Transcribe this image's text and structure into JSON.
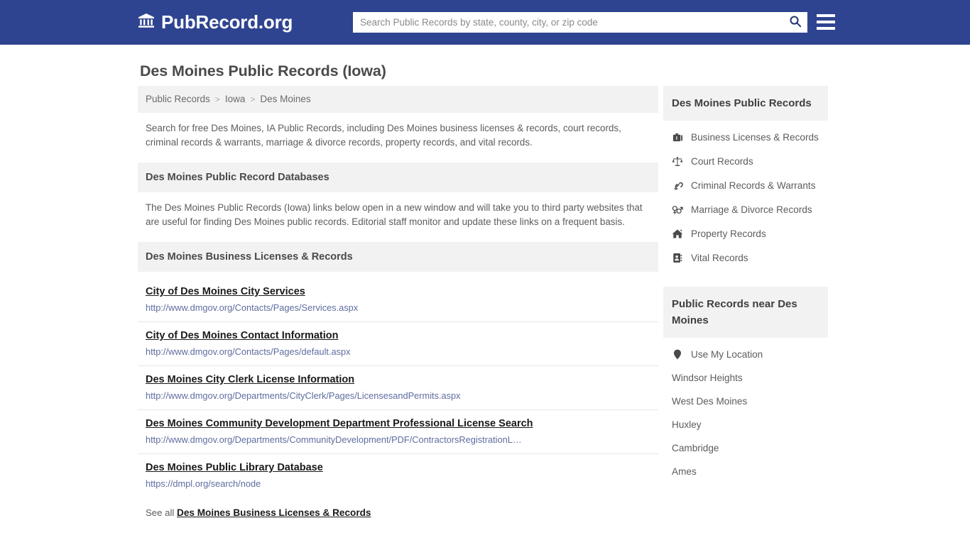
{
  "header": {
    "brand_name": "PubRecord.org",
    "brand_icon": "bank-building-icon",
    "search_placeholder": "Search Public Records by state, county, city, or zip code",
    "search_value": "",
    "search_icon": "search-icon",
    "menu_icon": "hamburger-menu-icon",
    "bg_color": "#2f4490"
  },
  "page": {
    "title": "Des Moines Public Records (Iowa)",
    "breadcrumb": [
      {
        "label": "Public Records"
      },
      {
        "label": "Iowa"
      },
      {
        "label": "Des Moines"
      }
    ],
    "breadcrumb_separator": ">",
    "intro": "Search for free Des Moines, IA Public Records, including Des Moines business licenses & records, court records, criminal records & warrants, marriage & divorce records, property records, and vital records.",
    "databases_heading": "Des Moines Public Record Databases",
    "databases_text": "The Des Moines Public Records (Iowa) links below open in a new window and will take you to third party websites that are useful for finding Des Moines public records. Editorial staff monitor and update these links on a frequent basis.",
    "list_heading": "Des Moines Business Licenses & Records",
    "links": [
      {
        "title": "City of Des Moines City Services",
        "url": "http://www.dmgov.org/Contacts/Pages/Services.aspx"
      },
      {
        "title": "City of Des Moines Contact Information",
        "url": "http://www.dmgov.org/Contacts/Pages/default.aspx"
      },
      {
        "title": "Des Moines City Clerk License Information",
        "url": "http://www.dmgov.org/Departments/CityClerk/Pages/LicensesandPermits.aspx"
      },
      {
        "title": "Des Moines Community Development Department Professional License Search",
        "url": "http://www.dmgov.org/Departments/CommunityDevelopment/PDF/ContractorsRegistrationL…"
      },
      {
        "title": "Des Moines Public Library Database",
        "url": "https://dmpl.org/search/node"
      }
    ],
    "see_all_prefix": "See all",
    "see_all_link": "Des Moines Business Licenses & Records"
  },
  "sidebar": {
    "records_heading": "Des Moines Public Records",
    "records_items": [
      {
        "label": "Business Licenses & Records",
        "icon": "briefcase-icon"
      },
      {
        "label": "Court Records",
        "icon": "scales-of-justice-icon"
      },
      {
        "label": "Criminal Records & Warrants",
        "icon": "handcuffs-icon"
      },
      {
        "label": "Marriage & Divorce Records",
        "icon": "venus-mars-icon"
      },
      {
        "label": "Property Records",
        "icon": "home-icon"
      },
      {
        "label": "Vital Records",
        "icon": "address-book-icon"
      }
    ],
    "nearby_heading": "Public Records near Des Moines",
    "nearby_items": [
      {
        "label": "Use My Location",
        "icon": "map-pin-icon"
      },
      {
        "label": "Windsor Heights",
        "icon": ""
      },
      {
        "label": "West Des Moines",
        "icon": ""
      },
      {
        "label": "Huxley",
        "icon": ""
      },
      {
        "label": "Cambridge",
        "icon": ""
      },
      {
        "label": "Ames",
        "icon": ""
      }
    ]
  }
}
